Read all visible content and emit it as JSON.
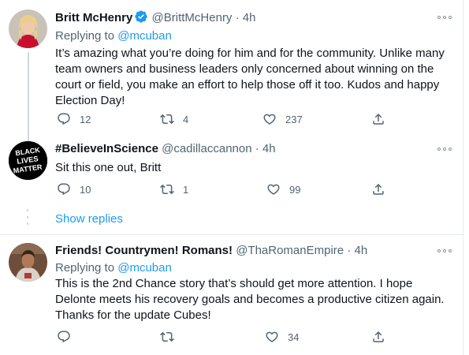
{
  "tweets": [
    {
      "name": "Britt McHenry",
      "handle": "@BrittMcHenry",
      "dot": "·",
      "time": "4h",
      "replying_prefix": "Replying to",
      "replying_mention": "@mcuban",
      "body": "It’s amazing what you’re doing for him and for the community. Unlike many team owners and business leaders only concerned about winning on the court or field, you make an effort to help those off it too. Kudos and happy Election Day!",
      "reply_count": "12",
      "retweet_count": "4",
      "like_count": "237"
    },
    {
      "name": "#BelieveInScience",
      "handle": "@cadillaccannon",
      "dot": "·",
      "time": "4h",
      "avatar_text": [
        "BLACK",
        "LIVES",
        "MATTER"
      ],
      "body": "Sit this one out, Britt",
      "reply_count": "10",
      "retweet_count": "1",
      "like_count": "99"
    },
    {
      "name": "Friends! Countrymen! Romans!",
      "handle": "@ThaRomanEmpire",
      "dot": "·",
      "time": "4h",
      "replying_prefix": "Replying to",
      "replying_mention": "@mcuban",
      "body": "This is the 2nd Chance story that’s should get more attention. I hope Delonte meets his recovery goals and becomes a productive citizen again. Thanks for the update Cubes!",
      "reply_count": "",
      "retweet_count": "",
      "like_count": "34"
    }
  ],
  "show_replies_label": "Show replies",
  "colors": {
    "link_blue": "#1d9bf0",
    "secondary_text": "#536471",
    "divider": "#e6ecf0"
  },
  "icons": [
    "verified-badge-icon",
    "more-icon",
    "reply-icon",
    "retweet-icon",
    "like-icon",
    "share-icon"
  ]
}
